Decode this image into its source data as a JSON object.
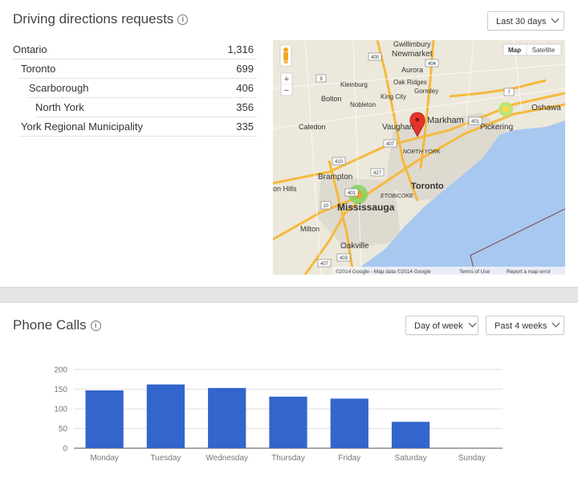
{
  "driving": {
    "title": "Driving directions requests",
    "range_dropdown": "Last 30 days",
    "rows": [
      {
        "label": "Ontario",
        "value": "1,316",
        "level": 0
      },
      {
        "label": "Toronto",
        "value": "699",
        "level": 1
      },
      {
        "label": "Scarborough",
        "value": "406",
        "level": 2
      },
      {
        "label": "North York",
        "value": "356",
        "level": 3
      },
      {
        "label": "York Regional Municipality",
        "value": "335",
        "level": 1
      }
    ],
    "map": {
      "map_button": "Map",
      "satellite_button": "Satellite",
      "zoom_in": "+",
      "zoom_out": "−",
      "attribution": "©2014 Google - Map data ©2014 Google",
      "terms": "Terms of Use",
      "report": "Report a map error",
      "places": [
        "Gwillimbury",
        "Newmarket",
        "Aurora",
        "Oak Ridges",
        "Gormley",
        "King City",
        "Nobleton",
        "Kleinburg",
        "Bolton",
        "Caledon",
        "Vaughan",
        "Markham",
        "Pickering",
        "Oshawa",
        "NORTH YORK",
        "Brampton",
        "Toronto",
        "ETOBICOKE",
        "on Hills",
        "Mississauga",
        "Milton",
        "Oakville"
      ],
      "route_shields": [
        "400",
        "404",
        "9",
        "7",
        "401",
        "407",
        "410",
        "427",
        "10",
        "401",
        "407",
        "403"
      ]
    }
  },
  "phone": {
    "title": "Phone Calls",
    "group_dropdown": "Day of week",
    "range_dropdown": "Past 4 weeks"
  },
  "chart_data": {
    "type": "bar",
    "categories": [
      "Monday",
      "Tuesday",
      "Wednesday",
      "Thursday",
      "Friday",
      "Saturday",
      "Sunday"
    ],
    "values": [
      147,
      162,
      153,
      131,
      126,
      67,
      0
    ],
    "ylim": [
      0,
      200
    ],
    "yticks": [
      0,
      50,
      100,
      150,
      200
    ],
    "grid": true,
    "bar_color": "#3366cc"
  },
  "colors": {
    "water": "#a8c8f0",
    "land": "#ece8dc",
    "highway": "#f5b93c",
    "marker": "#e5332a"
  }
}
